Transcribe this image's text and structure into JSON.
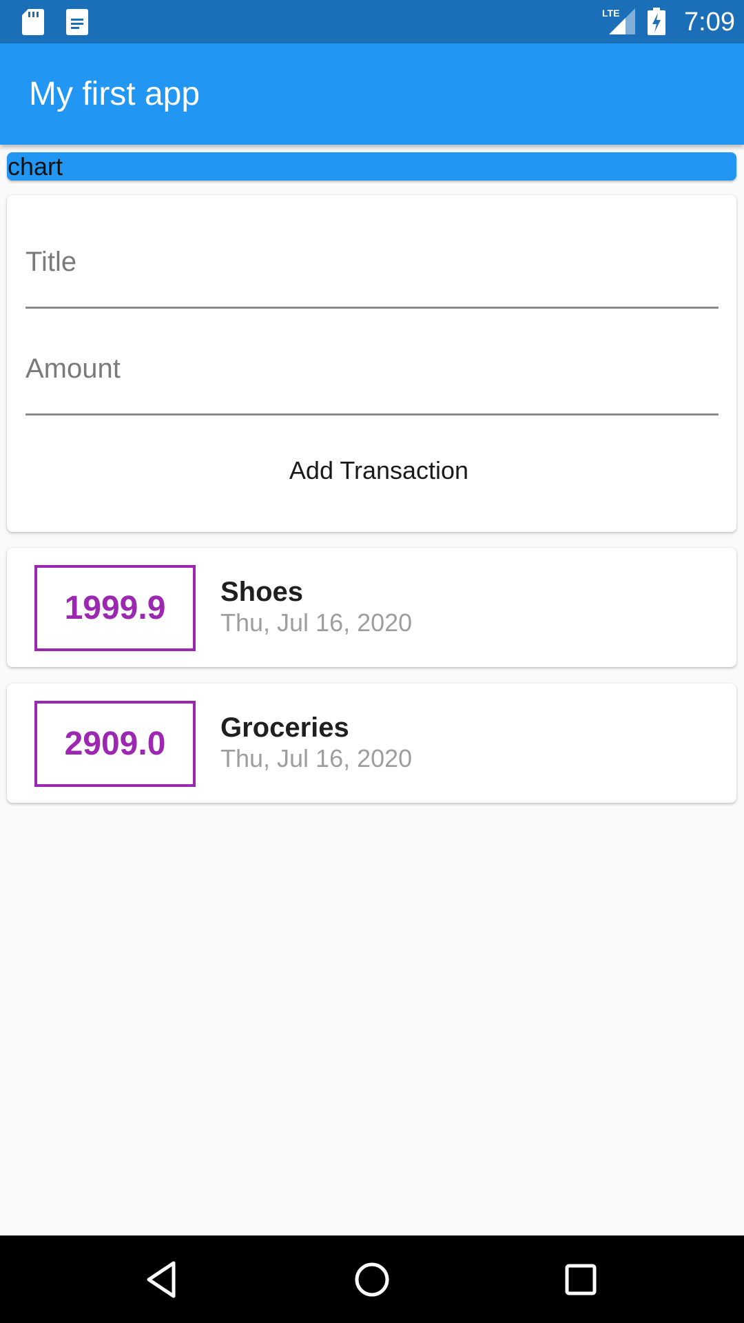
{
  "status_bar": {
    "time": "7:09",
    "icons": [
      "sd-card-icon",
      "document-icon",
      "lte-signal-icon",
      "battery-charging-icon"
    ],
    "lte_label": "LTE"
  },
  "app_bar": {
    "title": "My first app",
    "color": "#2196f3"
  },
  "chart": {
    "label": "chart"
  },
  "form": {
    "title_placeholder": "Title",
    "amount_placeholder": "Amount",
    "submit_label": "Add Transaction"
  },
  "transactions": [
    {
      "amount": "1999.9",
      "title": "Shoes",
      "date": "Thu, Jul 16, 2020"
    },
    {
      "amount": "2909.0",
      "title": "Groceries",
      "date": "Thu, Jul 16, 2020"
    }
  ],
  "accent_color": "#9c27b0",
  "nav_bar": {
    "icons": [
      "back-icon",
      "home-icon",
      "recents-icon"
    ]
  }
}
